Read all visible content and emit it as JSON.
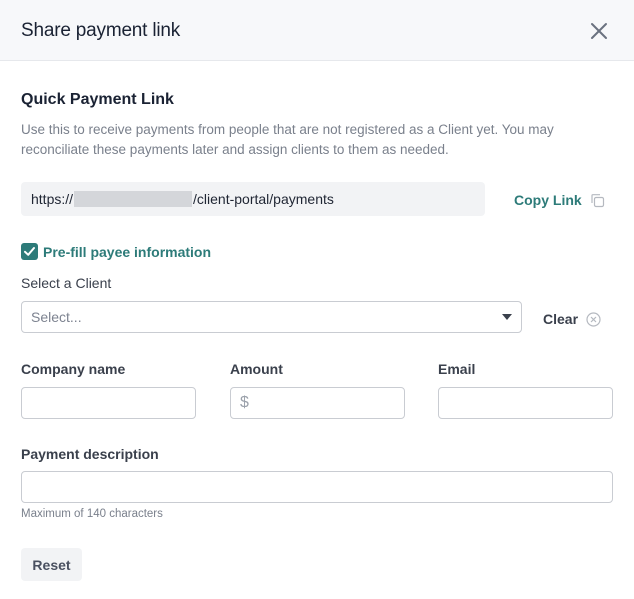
{
  "dialog": {
    "title": "Share payment link",
    "close_icon": "close-icon"
  },
  "quick_link": {
    "title": "Quick Payment Link",
    "description": "Use this to receive payments from people that are not registered as a Client yet. You may reconciliate these payments later and assign clients to them as needed.",
    "url_prefix": "https://",
    "url_suffix": "/client-portal/payments",
    "copy_label": "Copy Link",
    "copy_icon": "copy-icon"
  },
  "prefill": {
    "label": "Pre-fill payee information",
    "checked": true
  },
  "client": {
    "label": "Select a Client",
    "placeholder": "Select...",
    "clear_label": "Clear",
    "clear_icon": "clear-circle-icon"
  },
  "fields": {
    "company_label": "Company name",
    "company_value": "",
    "amount_label": "Amount",
    "amount_prefix": "$",
    "amount_value": "",
    "email_label": "Email",
    "email_value": "",
    "description_label": "Payment description",
    "description_value": "",
    "description_hint": "Maximum of 140 characters"
  },
  "actions": {
    "reset_label": "Reset"
  },
  "colors": {
    "accent": "#2d7b79",
    "header_bg": "#f7f8fa",
    "text_muted": "#7a808c"
  }
}
